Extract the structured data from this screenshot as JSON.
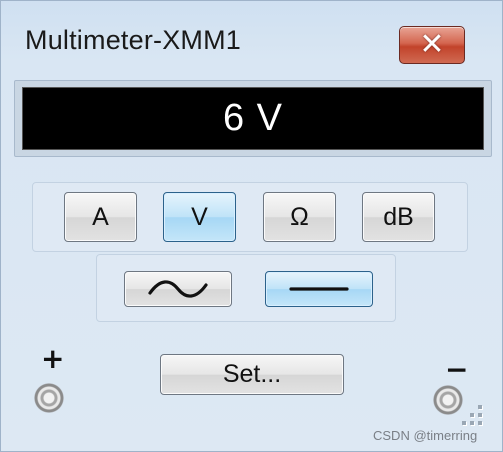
{
  "window": {
    "title": "Multimeter-XMM1",
    "close_glyph": "✕",
    "accent_close": "#d0583f"
  },
  "display": {
    "reading": "6 V",
    "background": "#000000",
    "text_color": "#ffffff"
  },
  "modes": [
    {
      "label": "A",
      "active": false
    },
    {
      "label": "V",
      "active": true
    },
    {
      "label": "Ω",
      "active": false
    },
    {
      "label": "dB",
      "active": false
    }
  ],
  "wave": {
    "ac": {
      "icon": "ac-sine-icon",
      "active": false
    },
    "dc": {
      "icon": "dc-line-icon",
      "active": true
    }
  },
  "set_label": "Set...",
  "terminals": {
    "plus_label": "+",
    "minus_label": "−"
  },
  "watermark": "CSDN @timerring"
}
